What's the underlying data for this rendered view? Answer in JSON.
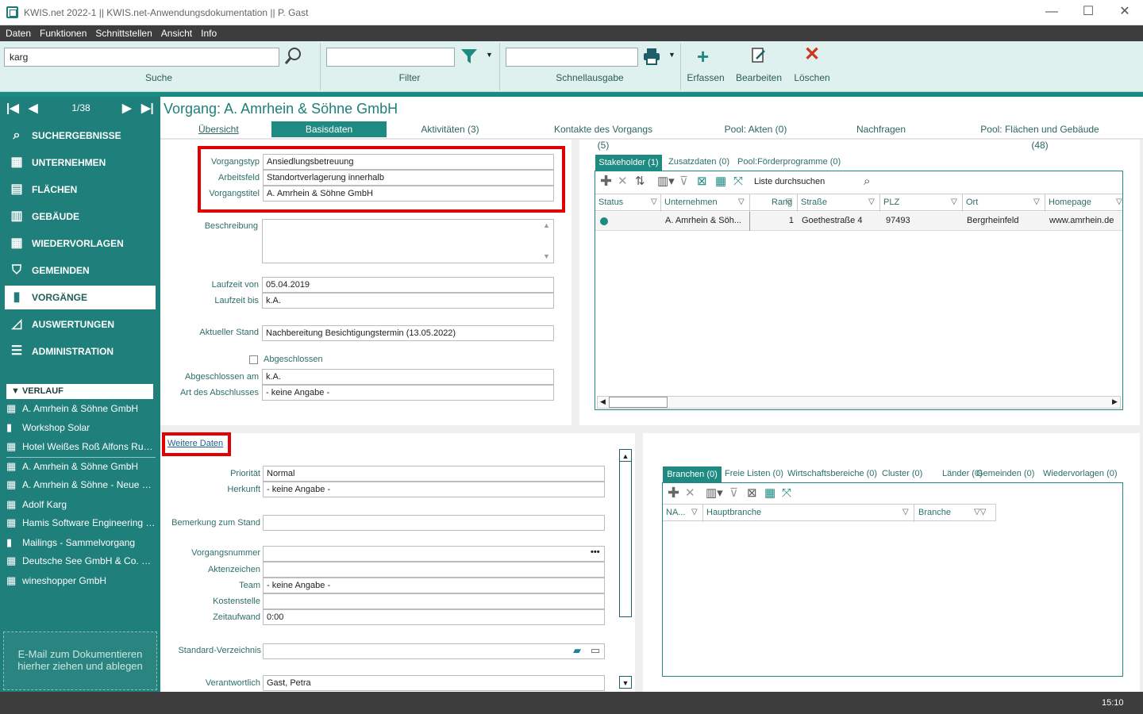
{
  "window": {
    "title": "KWIS.net 2022-1 || KWIS.net-Anwendungsdokumentation || P. Gast",
    "minimize": "—",
    "maximize": "☐",
    "close": "✕"
  },
  "menu": [
    "Daten",
    "Funktionen",
    "Schnittstellen",
    "Ansicht",
    "Info"
  ],
  "toolbar": {
    "search": {
      "value": "karg",
      "label": "Suche"
    },
    "filter": {
      "value": "",
      "label": "Filter"
    },
    "quick": {
      "value": "",
      "label": "Schnellausgabe"
    },
    "create": "Erfassen",
    "edit": "Bearbeiten",
    "delete": "Löschen"
  },
  "nav": {
    "pager": "1/38",
    "items": [
      {
        "label": "SUCHERGEBNISSE",
        "icon": "search-icon"
      },
      {
        "label": "UNTERNEHMEN",
        "icon": "building-icon"
      },
      {
        "label": "FLÄCHEN",
        "icon": "area-icon"
      },
      {
        "label": "GEBÄUDE",
        "icon": "building-icon"
      },
      {
        "label": "WIEDERVORLAGEN",
        "icon": "calendar-icon"
      },
      {
        "label": "GEMEINDEN",
        "icon": "shield-icon"
      },
      {
        "label": "VORGÄNGE",
        "icon": "folder-icon"
      },
      {
        "label": "AUSWERTUNGEN",
        "icon": "chart-icon"
      },
      {
        "label": "ADMINISTRATION",
        "icon": "settings-icon"
      }
    ],
    "history_title": "VERLAUF",
    "history": [
      "A. Amrhein & Söhne GmbH",
      "Workshop Solar",
      "Hotel Weißes Roß Alfons Rudl...",
      "A. Amrhein & Söhne GmbH",
      "A. Amrhein & Söhne - Neue Pr...",
      "Adolf Karg",
      "Hamis Software Engineering G...",
      "Mailings - Sammelvorgang",
      "Deutsche See GmbH & Co. KG...",
      "wineshopper GmbH"
    ],
    "drop": "E-Mail  zum Dokumentieren hierher ziehen und ablegen"
  },
  "page": {
    "title": "Vorgang: A. Amrhein & Söhne GmbH",
    "tabs": [
      "Übersicht",
      "Basisdaten",
      "Aktivitäten (3)",
      "Kontakte des Vorgangs (5)",
      "Pool: Akten (0)",
      "Nachfragen",
      "Pool: Flächen und Gebäude (48)"
    ]
  },
  "form": {
    "vorgangstyp": {
      "label": "Vorgangstyp",
      "value": "Ansiedlungsbetreuung"
    },
    "arbeitsfeld": {
      "label": "Arbeitsfeld",
      "value": "Standortverlagerung innerhalb"
    },
    "vorgangstitel": {
      "label": "Vorgangstitel",
      "value": "A. Amrhein & Söhne GmbH"
    },
    "beschreibung": {
      "label": "Beschreibung",
      "value": ""
    },
    "laufzeit_von": {
      "label": "Laufzeit von",
      "value": "05.04.2019"
    },
    "laufzeit_bis": {
      "label": "Laufzeit bis",
      "value": "k.A."
    },
    "stand": {
      "label": "Aktueller Stand",
      "value": "Nachbereitung Besichtigungstermin (13.05.2022)"
    },
    "abgeschlossen": "Abgeschlossen",
    "abgeschlossen_am": {
      "label": "Abgeschlossen am",
      "value": "k.A."
    },
    "art": {
      "label": "Art des Abschlusses",
      "value": "- keine Angabe -"
    }
  },
  "stakeholder": {
    "tabs": [
      "Stakeholder (1)",
      "Zusatzdaten (0)",
      "Pool:Förderprogramme (0)"
    ],
    "search_placeholder": "Liste durchsuchen",
    "columns": [
      "Status",
      "Unternehmen",
      "Rang",
      "Straße",
      "PLZ",
      "Ort",
      "Homepage"
    ],
    "row": {
      "unternehmen": "A. Amrhein & Söh...",
      "rang": "1",
      "strasse": "Goethestraße 4",
      "plz": "97493",
      "ort": "Bergrheinfeld",
      "homepage": "www.amrhein.de"
    }
  },
  "weitere": {
    "link": "Weitere Daten",
    "prioritaet": {
      "label": "Priorität",
      "value": "Normal"
    },
    "herkunft": {
      "label": "Herkunft",
      "value": "- keine Angabe -"
    },
    "bemerkung": {
      "label": "Bemerkung zum Stand",
      "value": ""
    },
    "nummer": {
      "label": "Vorgangsnummer",
      "value": ""
    },
    "aktenzeichen": {
      "label": "Aktenzeichen",
      "value": ""
    },
    "team": {
      "label": "Team",
      "value": "- keine Angabe -"
    },
    "kostenstelle": {
      "label": "Kostenstelle",
      "value": ""
    },
    "zeitaufwand": {
      "label": "Zeitaufwand",
      "value": "0:00"
    },
    "verzeichnis": {
      "label": "Standard-Verzeichnis",
      "value": ""
    },
    "verantwortlich": {
      "label": "Verantwortlich",
      "value": "Gast, Petra"
    }
  },
  "branchen": {
    "tabs": [
      "Branchen (0)",
      "Freie Listen (0)",
      "Wirtschaftsbereiche (0)",
      "Cluster (0)",
      "Länder (0)",
      "Gemeinden (0)",
      "Wiedervorlagen (0)"
    ],
    "columns": [
      "NA...",
      "Hauptbranche",
      "Branche"
    ]
  },
  "status": {
    "time": "15:10"
  },
  "colors": {
    "accent": "#1f7f7a",
    "highlight": "#e30000"
  }
}
